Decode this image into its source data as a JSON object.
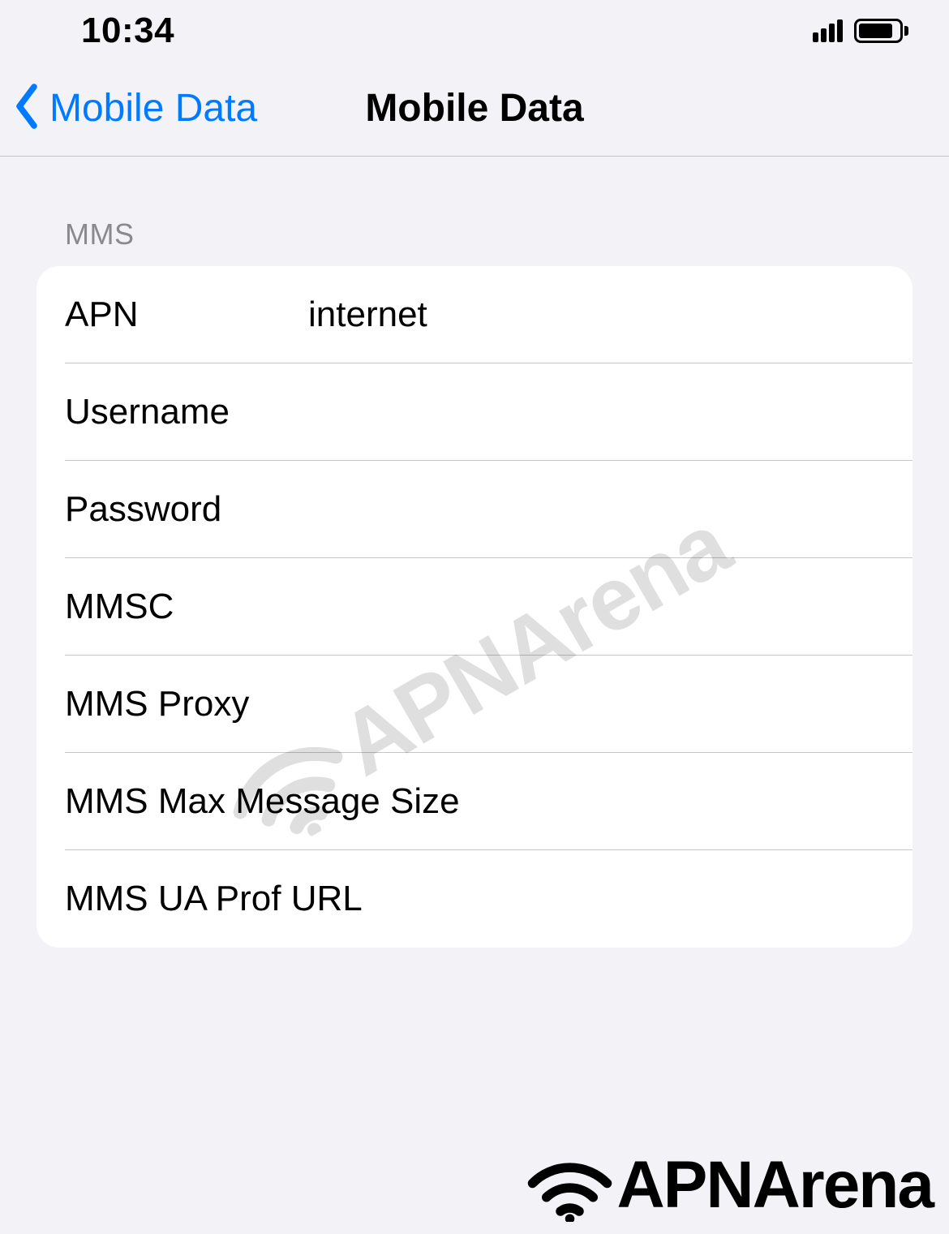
{
  "status_bar": {
    "time": "10:34"
  },
  "nav": {
    "back_label": "Mobile Data",
    "title": "Mobile Data"
  },
  "section": {
    "header": "MMS",
    "rows": {
      "apn": {
        "label": "APN",
        "value": "internet"
      },
      "username": {
        "label": "Username",
        "value": ""
      },
      "password": {
        "label": "Password",
        "value": ""
      },
      "mmsc": {
        "label": "MMSC",
        "value": ""
      },
      "mms_proxy": {
        "label": "MMS Proxy",
        "value": ""
      },
      "mms_max_size": {
        "label": "MMS Max Message Size",
        "value": ""
      },
      "mms_ua_prof": {
        "label": "MMS UA Prof URL",
        "value": ""
      }
    }
  },
  "watermark": {
    "text": "APNArena"
  }
}
